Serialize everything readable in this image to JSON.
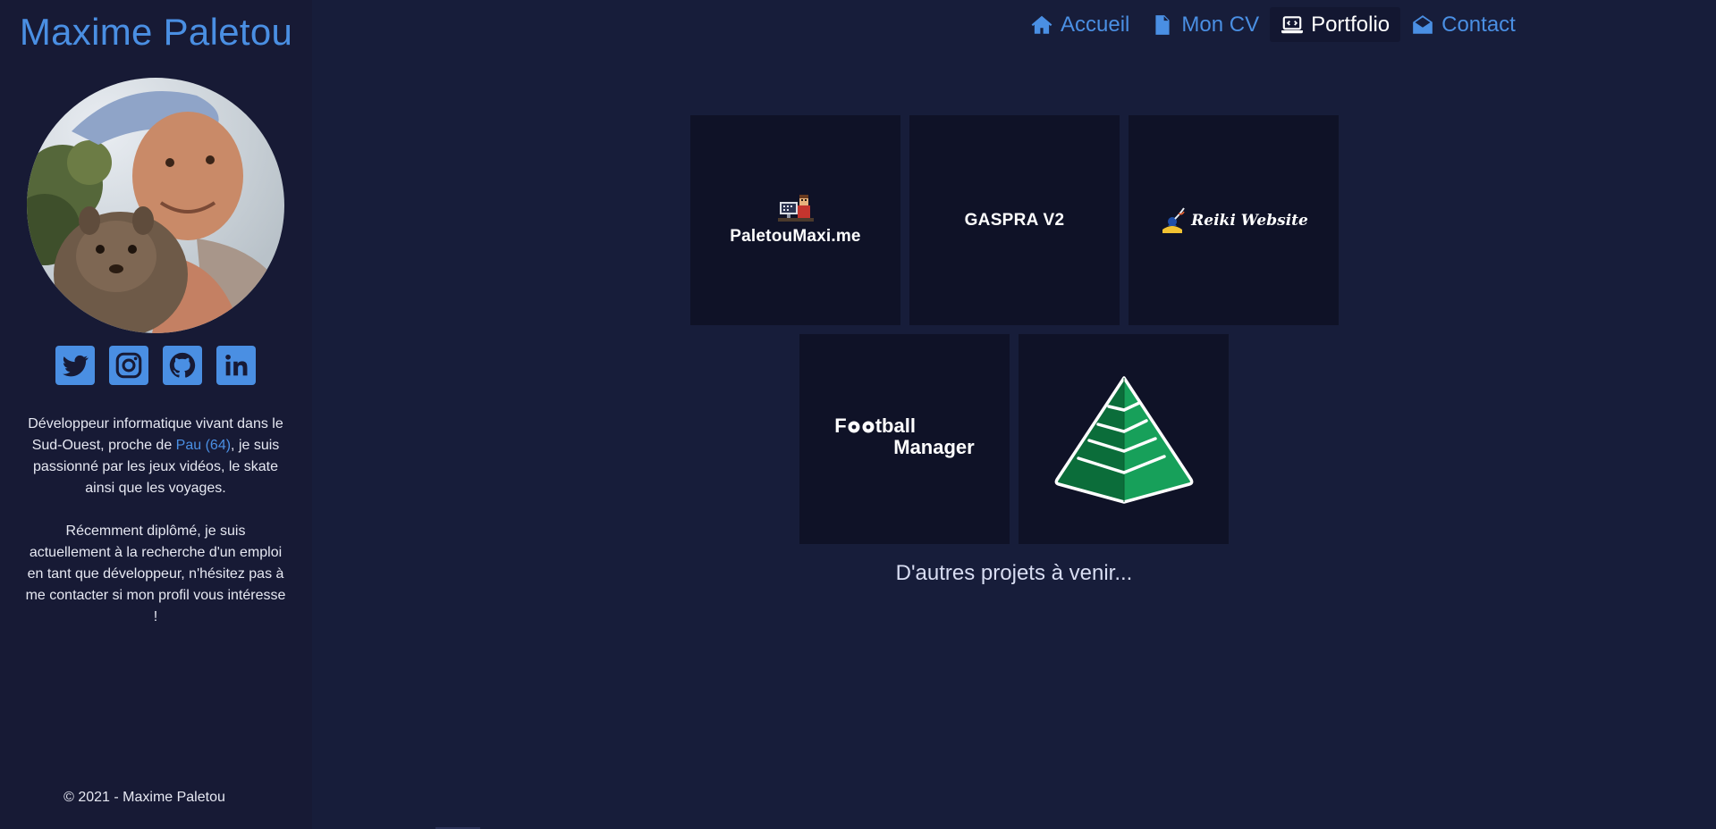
{
  "sidebar": {
    "title": "Maxime Paletou",
    "avatar_alt": "Photo de profil",
    "socials": [
      {
        "icon": "twitter-icon"
      },
      {
        "icon": "instagram-icon"
      },
      {
        "icon": "github-icon"
      },
      {
        "icon": "linkedin-icon"
      }
    ],
    "bio": {
      "p1_before": "Développeur informatique vivant dans le Sud-Ouest, proche de ",
      "p1_link": "Pau (64)",
      "p1_after": ", je suis passionné par les jeux vidéos, le skate ainsi que les voyages.",
      "p2": "Récemment diplômé, je suis actuellement à la recherche d'un emploi en tant que développeur, n'hésitez pas à me contacter si mon profil vous intéresse !"
    },
    "copyright": "© 2021 - Maxime Paletou"
  },
  "nav": {
    "items": [
      {
        "label": "Accueil",
        "icon": "home-icon"
      },
      {
        "label": "Mon CV",
        "icon": "document-icon"
      },
      {
        "label": "Portfolio",
        "icon": "laptop-code-icon",
        "active": true
      },
      {
        "label": "Contact",
        "icon": "envelope-open-icon"
      }
    ]
  },
  "portfolio": {
    "projects": [
      {
        "label": "PaletouMaxi.me"
      },
      {
        "label": "GASPRA V2"
      },
      {
        "label": "Reiki Website"
      },
      {
        "label_line1": "F",
        "label_line1_rest": "tball",
        "label_line2": "Manager"
      },
      {
        "label": ""
      }
    ],
    "more_text": "D'autres projets à venir..."
  },
  "colors": {
    "accent": "#4a8fe3",
    "background": "#171d3a",
    "sidebar": "#171a35",
    "tile": "#0f1227",
    "pyramid_light": "#17a05a",
    "pyramid_dark": "#0b6d3a"
  }
}
